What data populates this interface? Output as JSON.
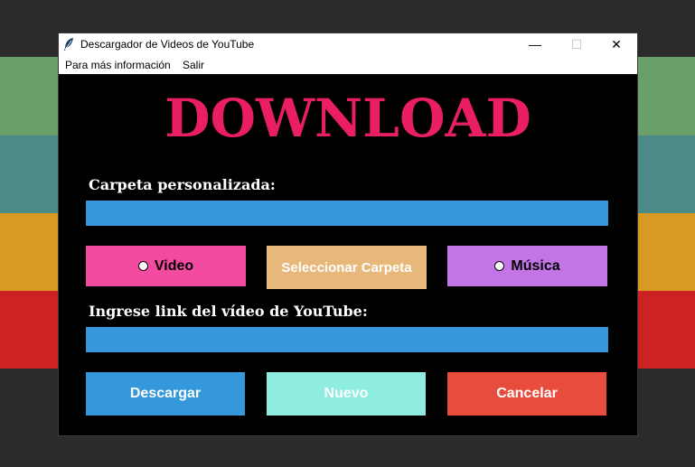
{
  "window": {
    "title": "Descargador de Videos de YouTube",
    "controls": {
      "minimize": "—",
      "maximize": "☐",
      "close": "✕"
    }
  },
  "menu": {
    "items": [
      "Para más información",
      "Salir"
    ]
  },
  "main": {
    "heading": "DOWNLOAD",
    "folder_label": "Carpeta personalizada:",
    "folder_value": "",
    "link_label": "Ingrese link del vídeo de YouTube:",
    "link_value": "",
    "options": {
      "video": "Video",
      "select_folder": "Seleccionar Carpeta",
      "music": "Música"
    },
    "actions": {
      "download": "Descargar",
      "new": "Nuevo",
      "cancel": "Cancelar"
    }
  },
  "colors": {
    "heading": "#e91e63",
    "entry": "#3498db",
    "video": "#f34ba0",
    "folder": "#e8b87a",
    "music": "#c374e5",
    "download": "#3498db",
    "new": "#8fede0",
    "cancel": "#e74c3c"
  },
  "icons": {
    "app": "feather-icon"
  }
}
